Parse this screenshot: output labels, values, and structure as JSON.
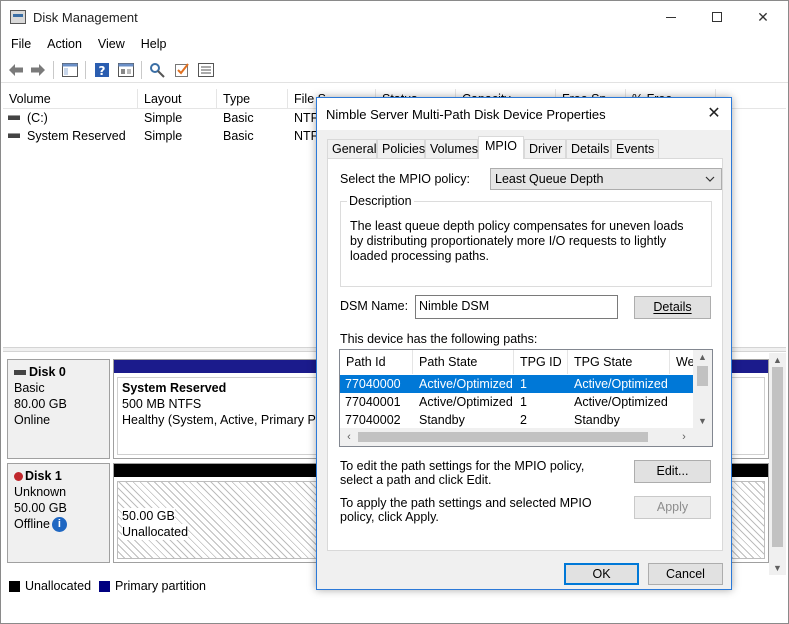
{
  "window": {
    "title": "Disk Management",
    "min_label": "",
    "max_label": "",
    "close_glyph": "✕"
  },
  "menu": [
    "File",
    "Action",
    "View",
    "Help"
  ],
  "toolbar": {
    "icons": [
      "back-arrow-icon",
      "forward-arrow-icon",
      "console-tree-icon",
      "help-icon",
      "properties-icon",
      "rescan-icon",
      "checklist-icon",
      "disk-list-icon"
    ]
  },
  "volume_list": {
    "columns": [
      "Volume",
      "Layout",
      "Type",
      "File S",
      "Status",
      "Capacity",
      "Free Sp",
      "% Free"
    ],
    "rows": [
      {
        "volume": "(C:)",
        "layout": "Simple",
        "type": "Basic",
        "fs": "NTF"
      },
      {
        "volume": "System Reserved",
        "layout": "Simple",
        "type": "Basic",
        "fs": "NTF"
      }
    ]
  },
  "disks": [
    {
      "name": "Disk 0",
      "kind": "Basic",
      "size": "80.00 GB",
      "status": "Online",
      "partition_title": "System Reserved",
      "partition_size": "500 MB NTFS",
      "partition_health": "Healthy (System, Active, Primary Pa"
    },
    {
      "name": "Disk 1",
      "kind": "Unknown",
      "size": "50.00 GB",
      "status": "Offline",
      "partition_size": "50.00 GB",
      "partition_status": "Unallocated"
    }
  ],
  "legend": [
    {
      "label": "Unallocated",
      "color": "#000000"
    },
    {
      "label": "Primary partition",
      "color": "#000080"
    }
  ],
  "colors": {
    "primary_partition": "#1b1b8c",
    "unallocated": "#000000",
    "selection": "#0078d7",
    "dialog_border": "#2b79d8"
  },
  "dialog": {
    "title": "Nimble Server  Multi-Path Disk Device Properties",
    "close_glyph": "✕",
    "tabs": [
      "General",
      "Policies",
      "Volumes",
      "MPIO",
      "Driver",
      "Details",
      "Events"
    ],
    "active_tab": "MPIO",
    "policy_label": "Select the MPIO policy:",
    "policy_value": "Least Queue Depth",
    "description_title": "Description",
    "description_text": "The least queue depth policy compensates for uneven loads by distributing proportionately more I/O requests to lightly loaded processing paths.",
    "dsm_label": "DSM Name:",
    "dsm_value": "Nimble DSM",
    "details_button": "Details",
    "paths_label": "This device has the following paths:",
    "paths_columns": [
      "Path Id",
      "Path State",
      "TPG ID",
      "TPG State",
      "We"
    ],
    "paths": [
      {
        "id": "77040000",
        "state": "Active/Optimized",
        "tpg_id": "1",
        "tpg_state": "Active/Optimized"
      },
      {
        "id": "77040001",
        "state": "Active/Optimized",
        "tpg_id": "1",
        "tpg_state": "Active/Optimized"
      },
      {
        "id": "77040002",
        "state": "Standby",
        "tpg_id": "2",
        "tpg_state": "Standby"
      }
    ],
    "edit_text": "To edit the path settings for the MPIO policy, select a path and click Edit.",
    "edit_button": "Edit...",
    "apply_text": "To apply the path settings and selected MPIO policy, click Apply.",
    "apply_button": "Apply",
    "ok_button": "OK",
    "cancel_button": "Cancel"
  }
}
